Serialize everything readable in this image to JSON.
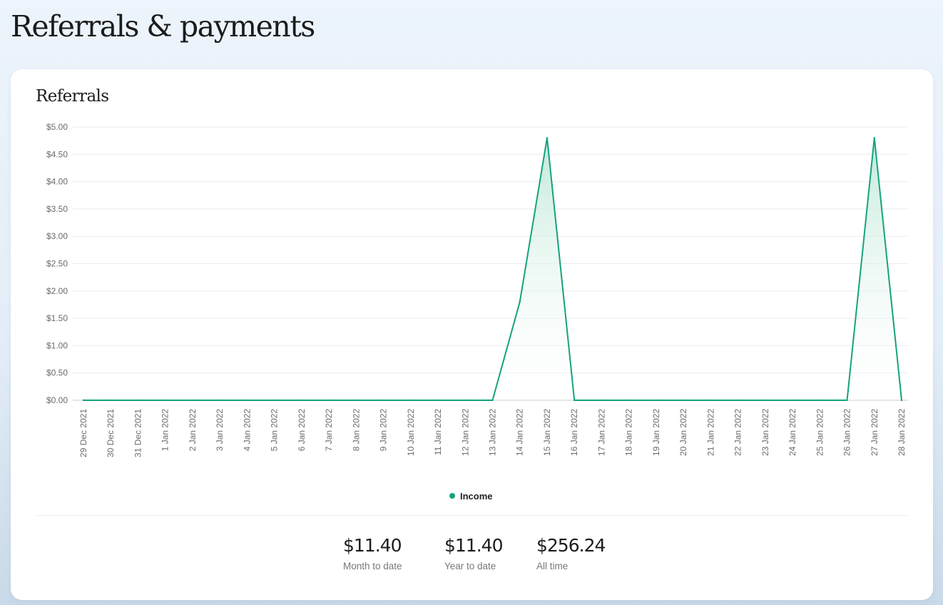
{
  "page": {
    "title": "Referrals & payments"
  },
  "card": {
    "title": "Referrals"
  },
  "chart_data": {
    "type": "area",
    "x": [
      "29 Dec 2021",
      "30 Dec 2021",
      "31 Dec 2021",
      "1 Jan 2022",
      "2 Jan 2022",
      "3 Jan 2022",
      "4 Jan 2022",
      "5 Jan 2022",
      "6 Jan 2022",
      "7 Jan 2022",
      "8 Jan 2022",
      "9 Jan 2022",
      "10 Jan 2022",
      "11 Jan 2022",
      "12 Jan 2022",
      "13 Jan 2022",
      "14 Jan 2022",
      "15 Jan 2022",
      "16 Jan 2022",
      "17 Jan 2022",
      "18 Jan 2022",
      "19 Jan 2022",
      "20 Jan 2022",
      "21 Jan 2022",
      "22 Jan 2022",
      "23 Jan 2022",
      "24 Jan 2022",
      "25 Jan 2022",
      "26 Jan 2022",
      "27 Jan 2022",
      "28 Jan 2022"
    ],
    "series": [
      {
        "name": "Income",
        "values": [
          0,
          0,
          0,
          0,
          0,
          0,
          0,
          0,
          0,
          0,
          0,
          0,
          0,
          0,
          0,
          0,
          1.8,
          4.8,
          0,
          0,
          0,
          0,
          0,
          0,
          0,
          0,
          0,
          0,
          0,
          4.8,
          0
        ]
      }
    ],
    "y_ticks": [
      "$0.00",
      "$0.50",
      "$1.00",
      "$1.50",
      "$2.00",
      "$2.50",
      "$3.00",
      "$3.50",
      "$4.00",
      "$4.50",
      "$5.00"
    ],
    "ylim": [
      0,
      5
    ],
    "grid": true,
    "legend": "bottom-center",
    "colors": {
      "line": "#14a37f",
      "fill_top": "#bfe8d9",
      "grid": "#e8ebee",
      "baseline": "#c8cbce",
      "tick_text": "#6b6b6b"
    }
  },
  "legend": {
    "label": "Income",
    "color": "#14a37f"
  },
  "stats": {
    "month_value": "$11.40",
    "month_label": "Month to date",
    "year_value": "$11.40",
    "year_label": "Year to date",
    "all_value": "$256.24",
    "all_label": "All time"
  }
}
